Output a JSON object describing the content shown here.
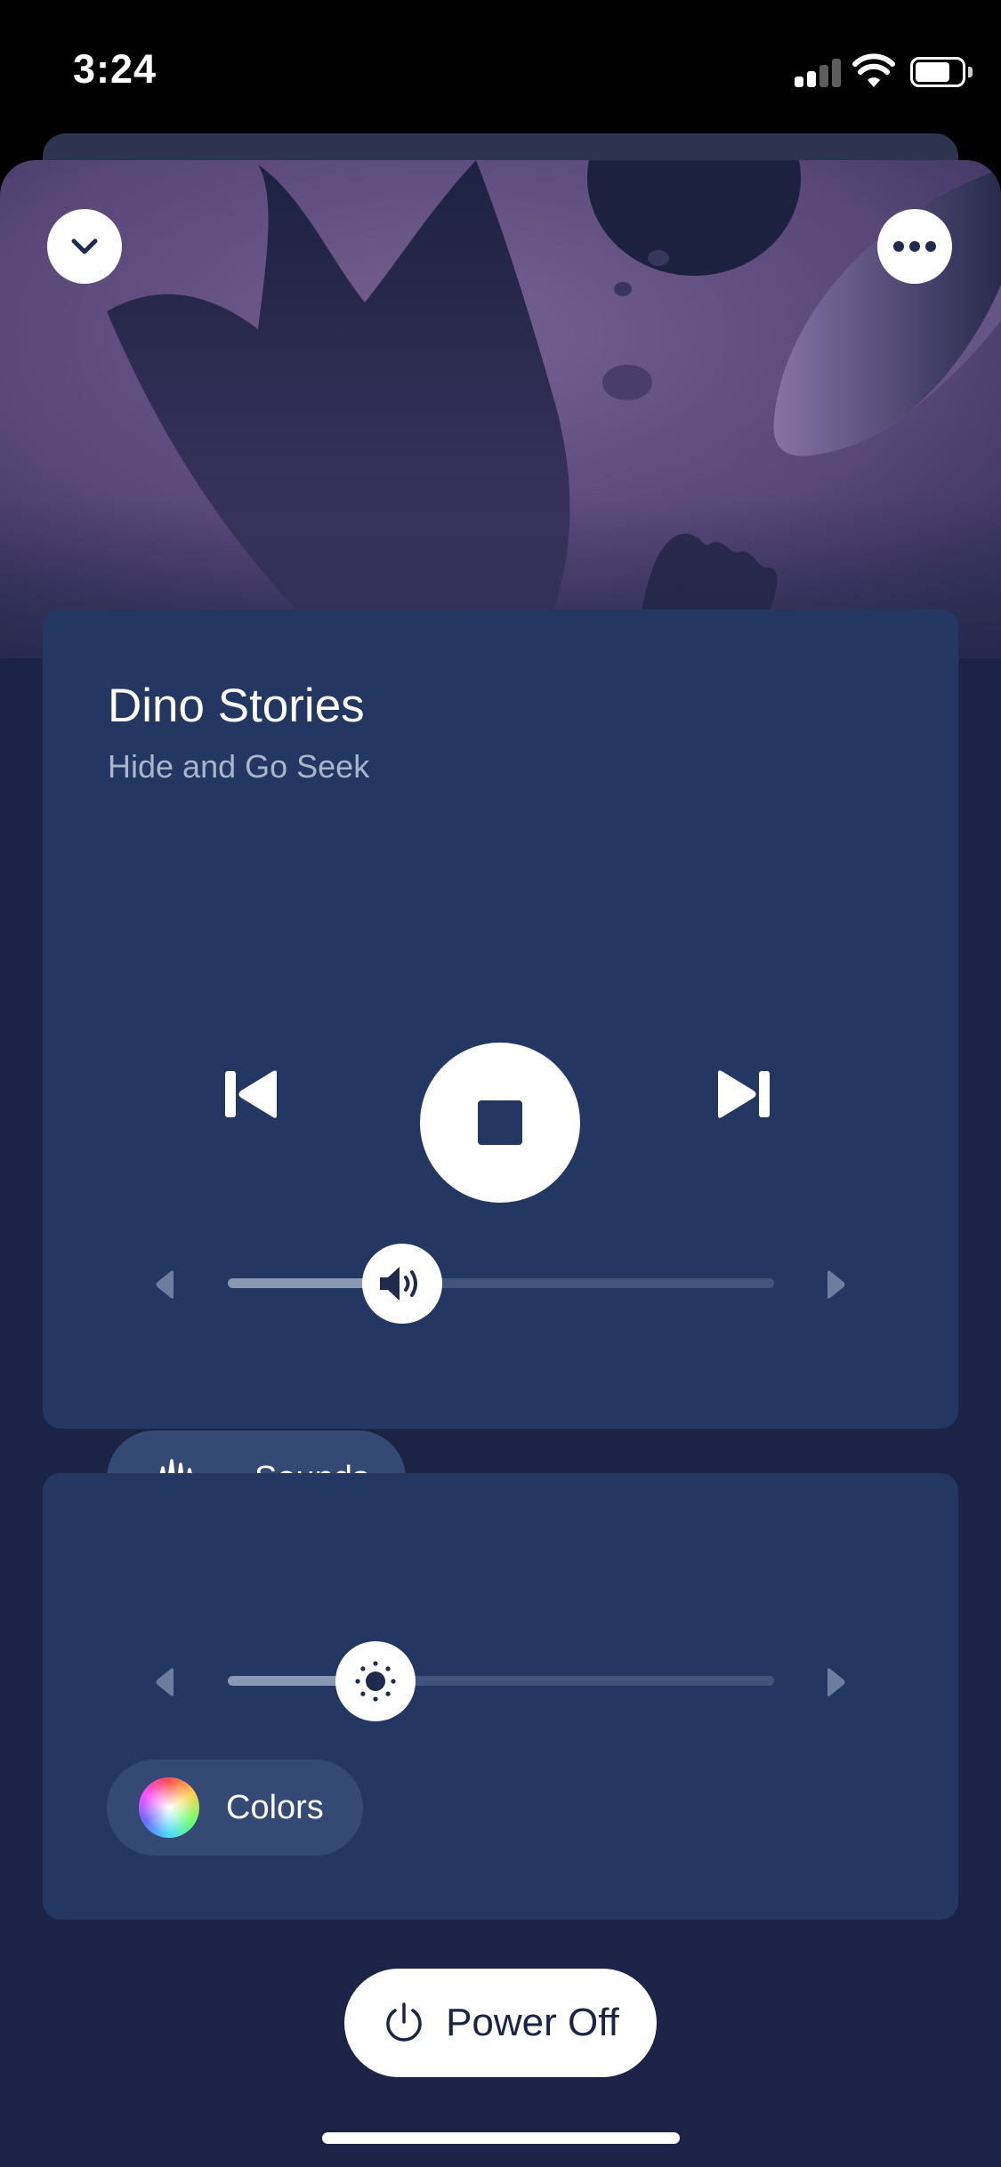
{
  "status_bar": {
    "time": "3:24"
  },
  "header": {
    "collapse_icon": "chevron-down-icon",
    "more_icon": "more-horizontal-icon"
  },
  "player": {
    "title": "Dino Stories",
    "subtitle": "Hide and Go Seek",
    "prev_icon": "skip-previous-icon",
    "stop_icon": "stop-icon",
    "next_icon": "skip-next-icon",
    "volume": {
      "icon": "speaker-icon",
      "level": 0.32
    },
    "sounds_label": "Sounds",
    "sounds_icon": "sound-wave-icon"
  },
  "light": {
    "brightness": {
      "icon": "sun-icon",
      "level": 0.27
    },
    "colors_label": "Colors",
    "colors_icon": "color-wheel-icon"
  },
  "power": {
    "label": "Power Off",
    "icon": "power-icon"
  },
  "colors": {
    "sheet_bg": "#1b2446",
    "card_bg": "#233762",
    "pill_bg": "#344a74",
    "artwork_purple": "#6e5a8c"
  }
}
